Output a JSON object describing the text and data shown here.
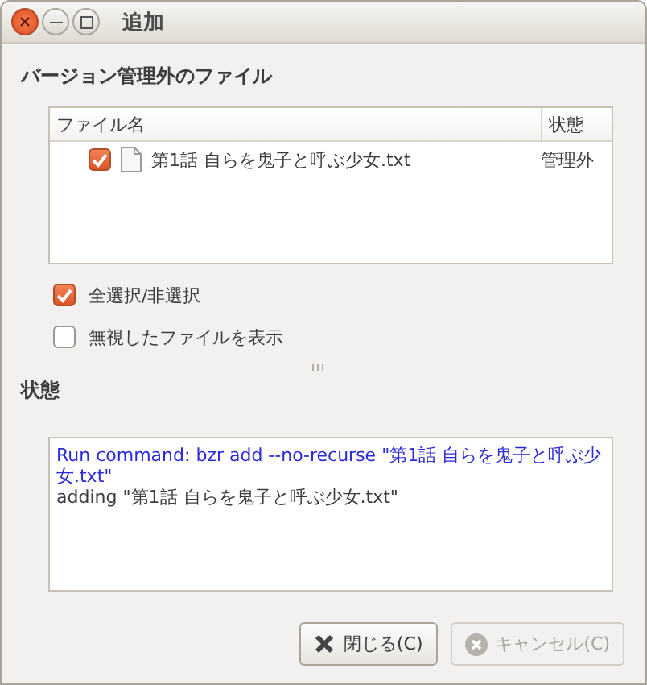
{
  "window": {
    "title": "追加"
  },
  "untracked": {
    "heading": "バージョン管理外のファイル",
    "columns": [
      "ファイル名",
      "状態"
    ],
    "rows": [
      {
        "checked": true,
        "name": "第1話 自らを鬼子と呼ぶ少女.txt",
        "status": "管理外"
      }
    ]
  },
  "options": [
    {
      "label": "全選択/非選択",
      "checked": true
    },
    {
      "label": "無視したファイルを表示",
      "checked": false
    }
  ],
  "status": {
    "heading": "状態",
    "log": [
      {
        "kind": "command",
        "text": "Run command: bzr add --no-recurse \"第1話 自らを鬼子と呼ぶ少女.txt\""
      },
      {
        "kind": "output",
        "text": "adding \"第1話 自らを鬼子と呼ぶ少女.txt\""
      }
    ]
  },
  "buttons": [
    {
      "label": "閉じる(C)",
      "disabled": false,
      "kind": "close"
    },
    {
      "label": "キャンセル(C)",
      "disabled": true,
      "kind": "cancel"
    }
  ]
}
